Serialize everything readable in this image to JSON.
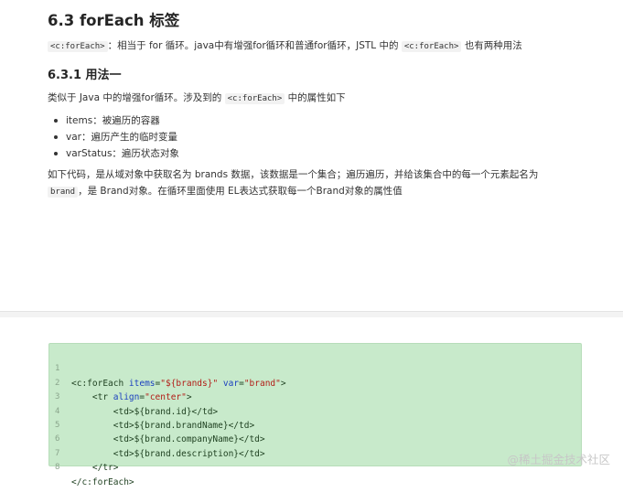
{
  "heading": "6.3 forEach 标签",
  "intro": {
    "code1": "<c:forEach>",
    "text1": "：相当于 for 循环。java中有增强for循环和普通for循环，JSTL 中的",
    "code2": "<c:forEach>",
    "text2": "也有两种用法"
  },
  "subheading": "6.3.1 用法一",
  "para1": {
    "text1": "类似于 Java 中的增强for循环。涉及到的",
    "code": "<c:forEach>",
    "text2": "中的属性如下"
  },
  "list": [
    "items：被遍历的容器",
    "var：遍历产生的临时变量",
    "varStatus：遍历状态对象"
  ],
  "para2": {
    "line1": "如下代码，是从域对象中获取名为 brands 数据，该数据是一个集合；遍历遍历，并给该集合中的每一个元素起名为",
    "code": "brand",
    "line2": "，是 Brand对象。在循环里面使用 EL表达式获取每一个Brand对象的属性值"
  },
  "code_block": {
    "line_numbers": [
      "1",
      "2",
      "3",
      "4",
      "5",
      "6",
      "7",
      "8"
    ],
    "l1": {
      "open": "<c:forEach ",
      "attr1": "items",
      "eq1": "=",
      "val1": "\"${brands}\"",
      "sp": " ",
      "attr2": "var",
      "eq2": "=",
      "val2": "\"brand\"",
      "close": ">"
    },
    "l2": {
      "open": "    <tr ",
      "attr": "align",
      "eq": "=",
      "val": "\"center\"",
      "close": ">"
    },
    "l3": "        <td>${brand.id}</td>",
    "l4": "        <td>${brand.brandName}</td>",
    "l5": "        <td>${brand.companyName}</td>",
    "l6": "        <td>${brand.description}</td>",
    "l7": "    </tr>",
    "l8": "</c:forEach>"
  },
  "watermark": "@稀土掘金技术社区",
  "colors": {
    "code_bg": "#c8eacb",
    "attr": "#1a3fbf",
    "string": "#b21d17"
  }
}
